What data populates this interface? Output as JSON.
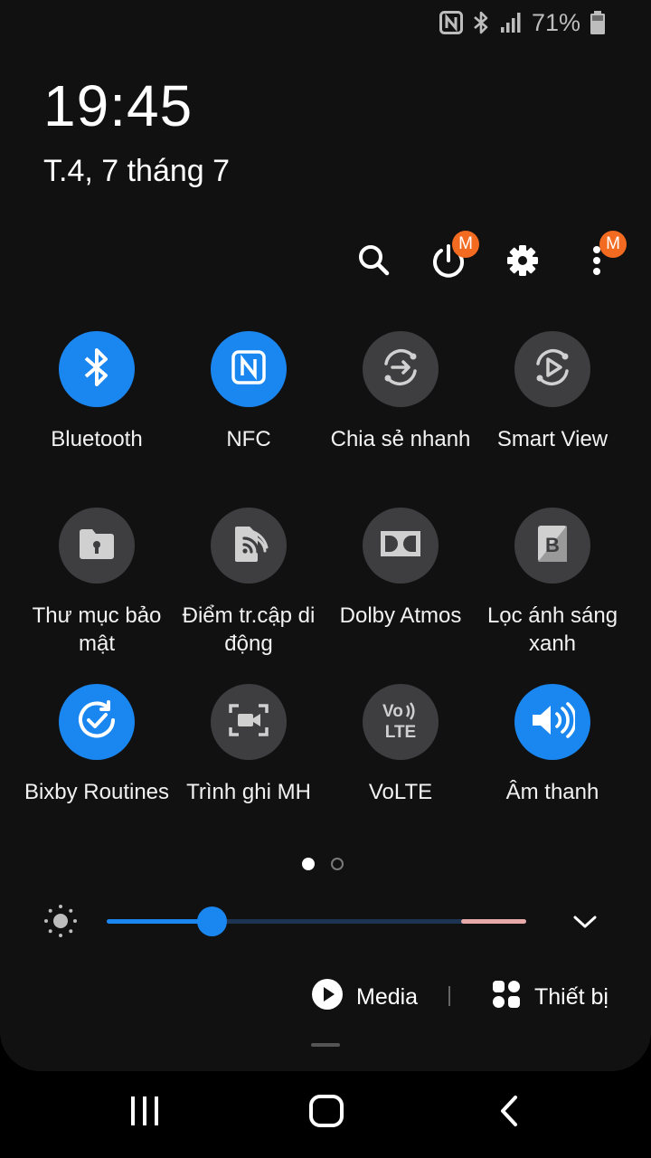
{
  "status_bar": {
    "icons": [
      "nfc-icon",
      "bluetooth-icon",
      "signal-icon",
      "battery-icon"
    ],
    "battery_percent": "71%"
  },
  "header": {
    "time": "19:45",
    "date": "T.4, 7 tháng 7"
  },
  "toolbar": {
    "icons": [
      "search-icon",
      "power-icon",
      "gear-icon",
      "more-icon"
    ],
    "power_badge": "M",
    "more_badge": "M"
  },
  "tiles": [
    {
      "label": "Bluetooth",
      "icon": "bluetooth-icon",
      "active": true
    },
    {
      "label": "NFC",
      "icon": "nfc-icon",
      "active": true
    },
    {
      "label": "Chia sẻ nhanh",
      "icon": "quick-share-icon",
      "active": false
    },
    {
      "label": "Smart View",
      "icon": "smart-view-icon",
      "active": false
    },
    {
      "label": "Thư mục bảo mật",
      "icon": "secure-folder-icon",
      "active": false
    },
    {
      "label": "Điểm tr.cập di động",
      "icon": "mobile-hotspot-icon",
      "active": false
    },
    {
      "label": "Dolby Atmos",
      "icon": "dolby-icon",
      "active": false
    },
    {
      "label": "Lọc ánh sáng xanh",
      "icon": "blue-light-filter-icon",
      "active": false
    },
    {
      "label": "Bixby Routines",
      "icon": "bixby-routines-icon",
      "active": true
    },
    {
      "label": "Trình ghi MH",
      "icon": "screen-recorder-icon",
      "active": false
    },
    {
      "label": "VoLTE",
      "icon": "volte-icon",
      "active": false
    },
    {
      "label": "Âm thanh",
      "icon": "sound-icon",
      "active": true
    }
  ],
  "page_indicator": {
    "current": 1,
    "total": 2
  },
  "brightness": {
    "level": 0.25
  },
  "colors": {
    "accent": "#1a86f0",
    "badge": "#f26b21",
    "tile_off": "#3e3e40",
    "panel": "#111112"
  },
  "bottom": {
    "media_label": "Media",
    "devices_label": "Thiết bị"
  },
  "navbar": {
    "icons": [
      "recents-icon",
      "home-icon",
      "back-icon"
    ]
  }
}
